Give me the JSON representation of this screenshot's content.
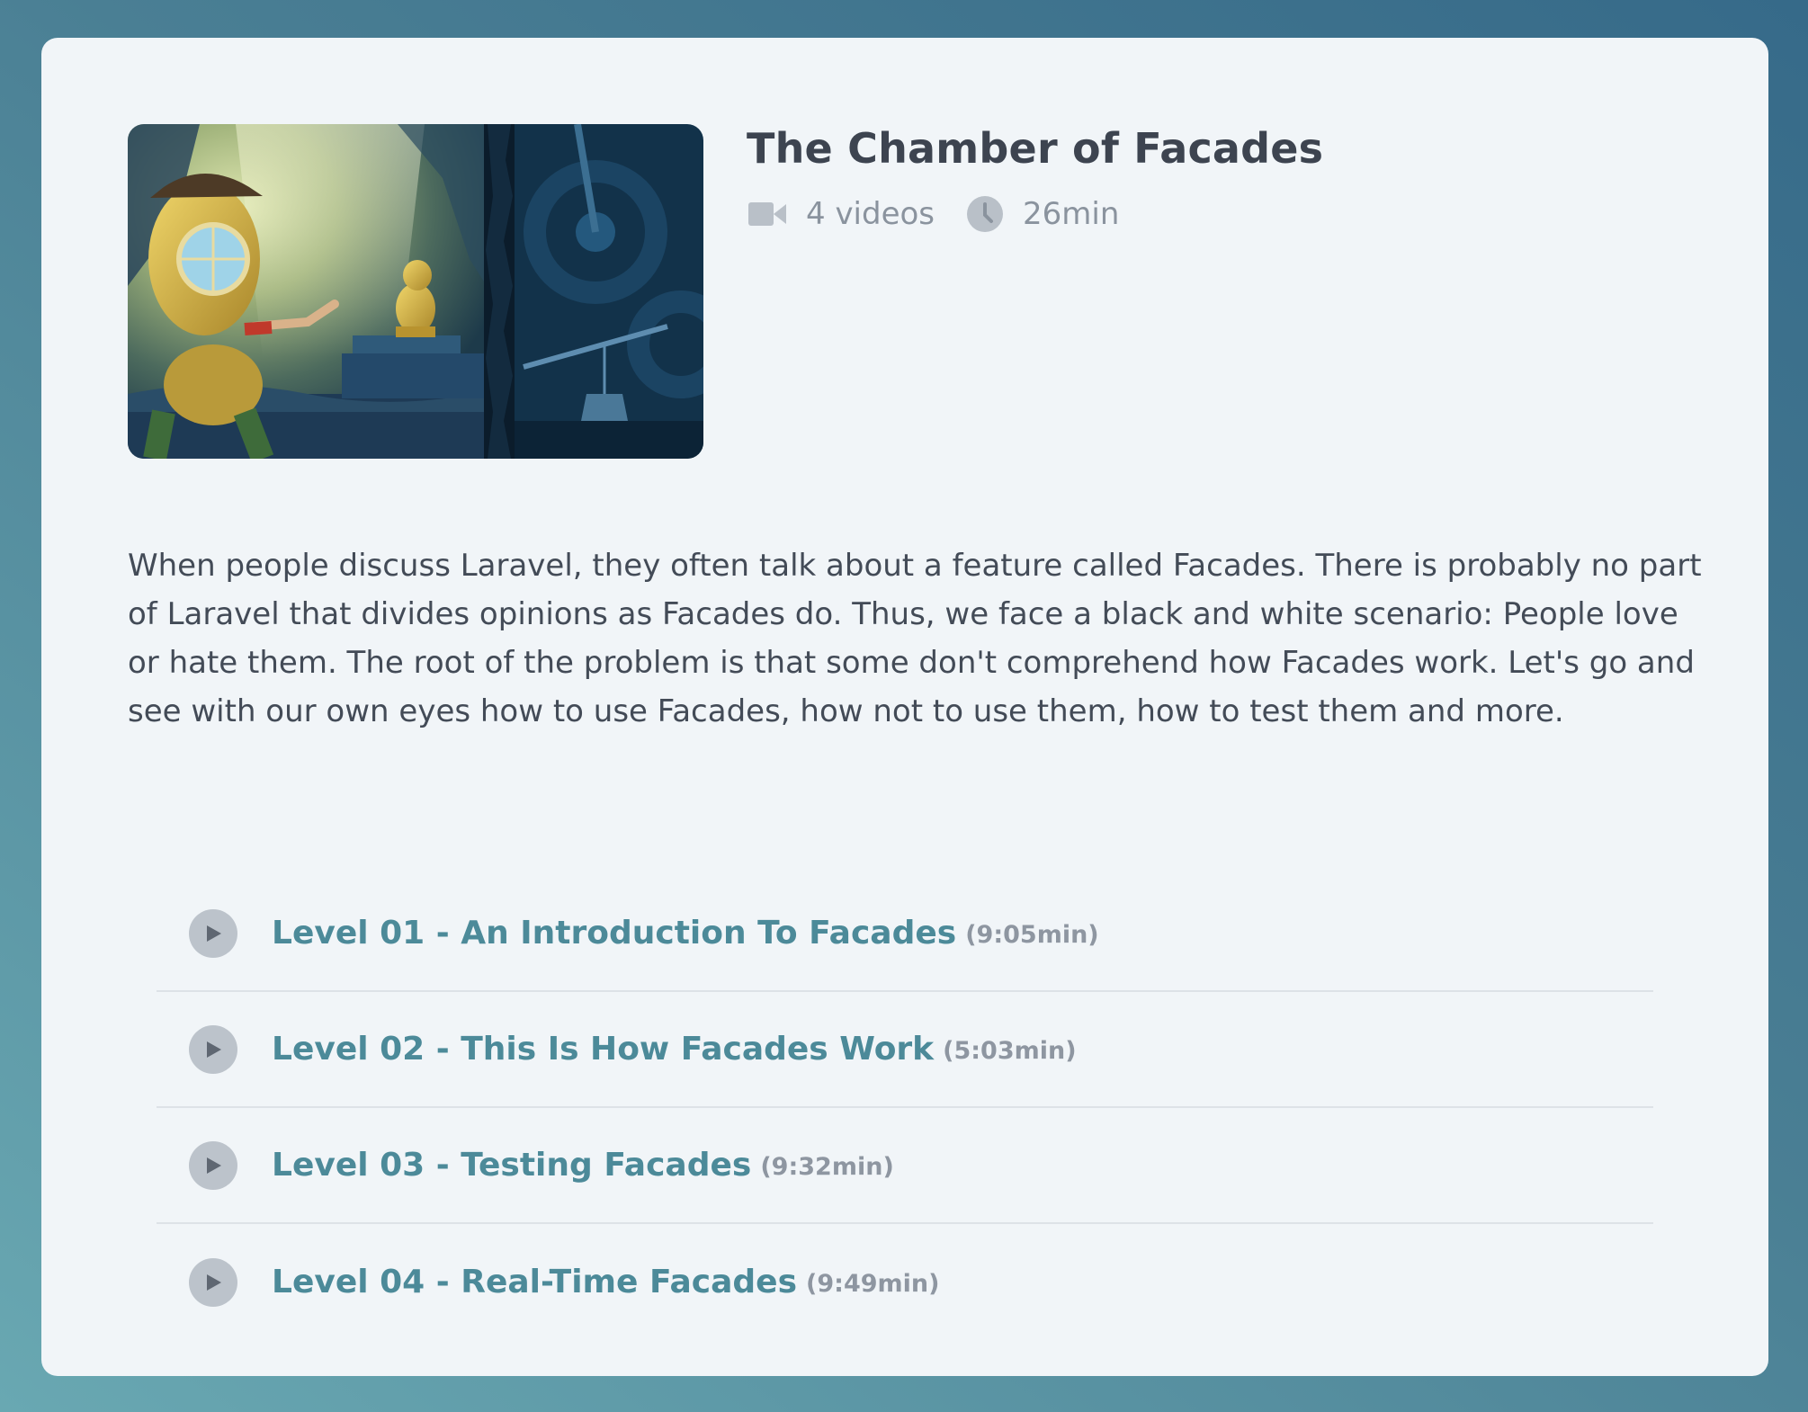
{
  "course": {
    "title": "The Chamber of Facades",
    "videos": "4 videos",
    "duration": "26min",
    "description": "When people discuss Laravel, they often talk about a feature called Facades. There is probably no part of Laravel that divides opinions as Facades do. Thus, we face a black and white scenario: People love or hate them. The root of the problem is that some don't comprehend how Facades work. Let's go and see with our own eyes how to use Facades, how not to use them, how to test them and more.",
    "thumbnail_icon": "illustration-diver-idol",
    "video_icon": "video-camera-icon",
    "clock_icon": "clock-icon"
  },
  "levels": [
    {
      "title": "Level 01 - An Introduction To Facades",
      "duration": "(9:05min)",
      "icon": "play-icon"
    },
    {
      "title": "Level 02 - This Is How Facades Work",
      "duration": "(5:03min)",
      "icon": "play-icon"
    },
    {
      "title": "Level 03 - Testing Facades",
      "duration": "(9:32min)",
      "icon": "play-icon"
    },
    {
      "title": "Level 04 - Real-Time Facades",
      "duration": "(9:49min)",
      "icon": "play-icon"
    }
  ],
  "colors": {
    "accent": "#4c8a99",
    "card": "#f1f5f8",
    "text": "#3d4450",
    "muted": "#8a939e"
  }
}
